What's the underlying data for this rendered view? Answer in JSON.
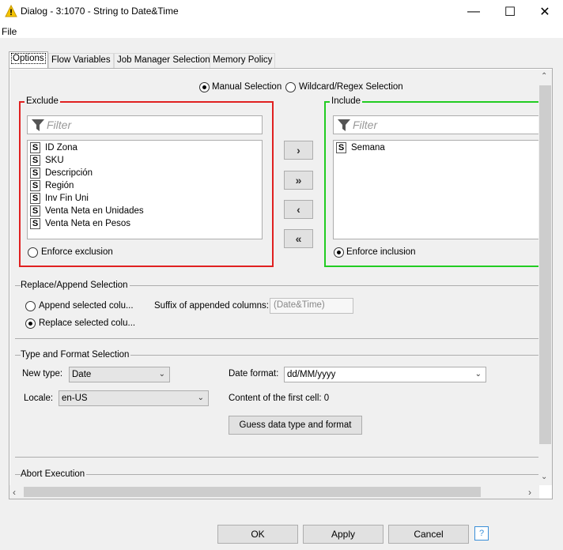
{
  "window": {
    "title": "Dialog - 3:1070 - String to Date&Time",
    "minimize": "—",
    "maximize": "☐",
    "close": "✕"
  },
  "menu": {
    "file": "File"
  },
  "tabs": [
    "Options",
    "Flow Variables",
    "Job Manager Selection",
    "Memory Policy"
  ],
  "selection_mode": {
    "manual": "Manual Selection",
    "wildcard": "Wildcard/Regex Selection",
    "selected": "manual"
  },
  "exclude": {
    "label": "Exclude",
    "filter_placeholder": "Filter",
    "items": [
      "ID Zona",
      "SKU",
      "Descripción",
      "Región",
      "Inv Fin Uni",
      "Venta Neta en Unidades",
      "Venta Neta en Pesos"
    ],
    "enforce_label": "Enforce exclusion",
    "enforce_selected": false
  },
  "include": {
    "label": "Include",
    "filter_placeholder": "Filter",
    "items": [
      "Semana"
    ],
    "enforce_label": "Enforce inclusion",
    "enforce_selected": true
  },
  "type_badge": "S",
  "move_buttons": {
    "add": "›",
    "add_all": "»",
    "remove": "‹",
    "remove_all": "«"
  },
  "replace_append": {
    "title": "Replace/Append Selection",
    "append_label": "Append selected colu...",
    "replace_label": "Replace selected colu...",
    "selected": "replace",
    "suffix_label": "Suffix of appended columns:",
    "suffix_value": "(Date&Time)"
  },
  "type_format": {
    "title": "Type and Format Selection",
    "new_type_label": "New type:",
    "new_type_value": "Date",
    "date_format_label": "Date format:",
    "date_format_value": "dd/MM/yyyy",
    "locale_label": "Locale:",
    "locale_value": "en-US",
    "first_cell_text": "Content of the first cell: 0",
    "guess_button": "Guess data type and format"
  },
  "abort": {
    "title": "Abort Execution"
  },
  "buttons": {
    "ok": "OK",
    "apply": "Apply",
    "cancel": "Cancel",
    "help": "?"
  },
  "colors": {
    "exclude_border": "#e02020",
    "include_border": "#22cc22",
    "warning_icon": "#f5c400"
  }
}
